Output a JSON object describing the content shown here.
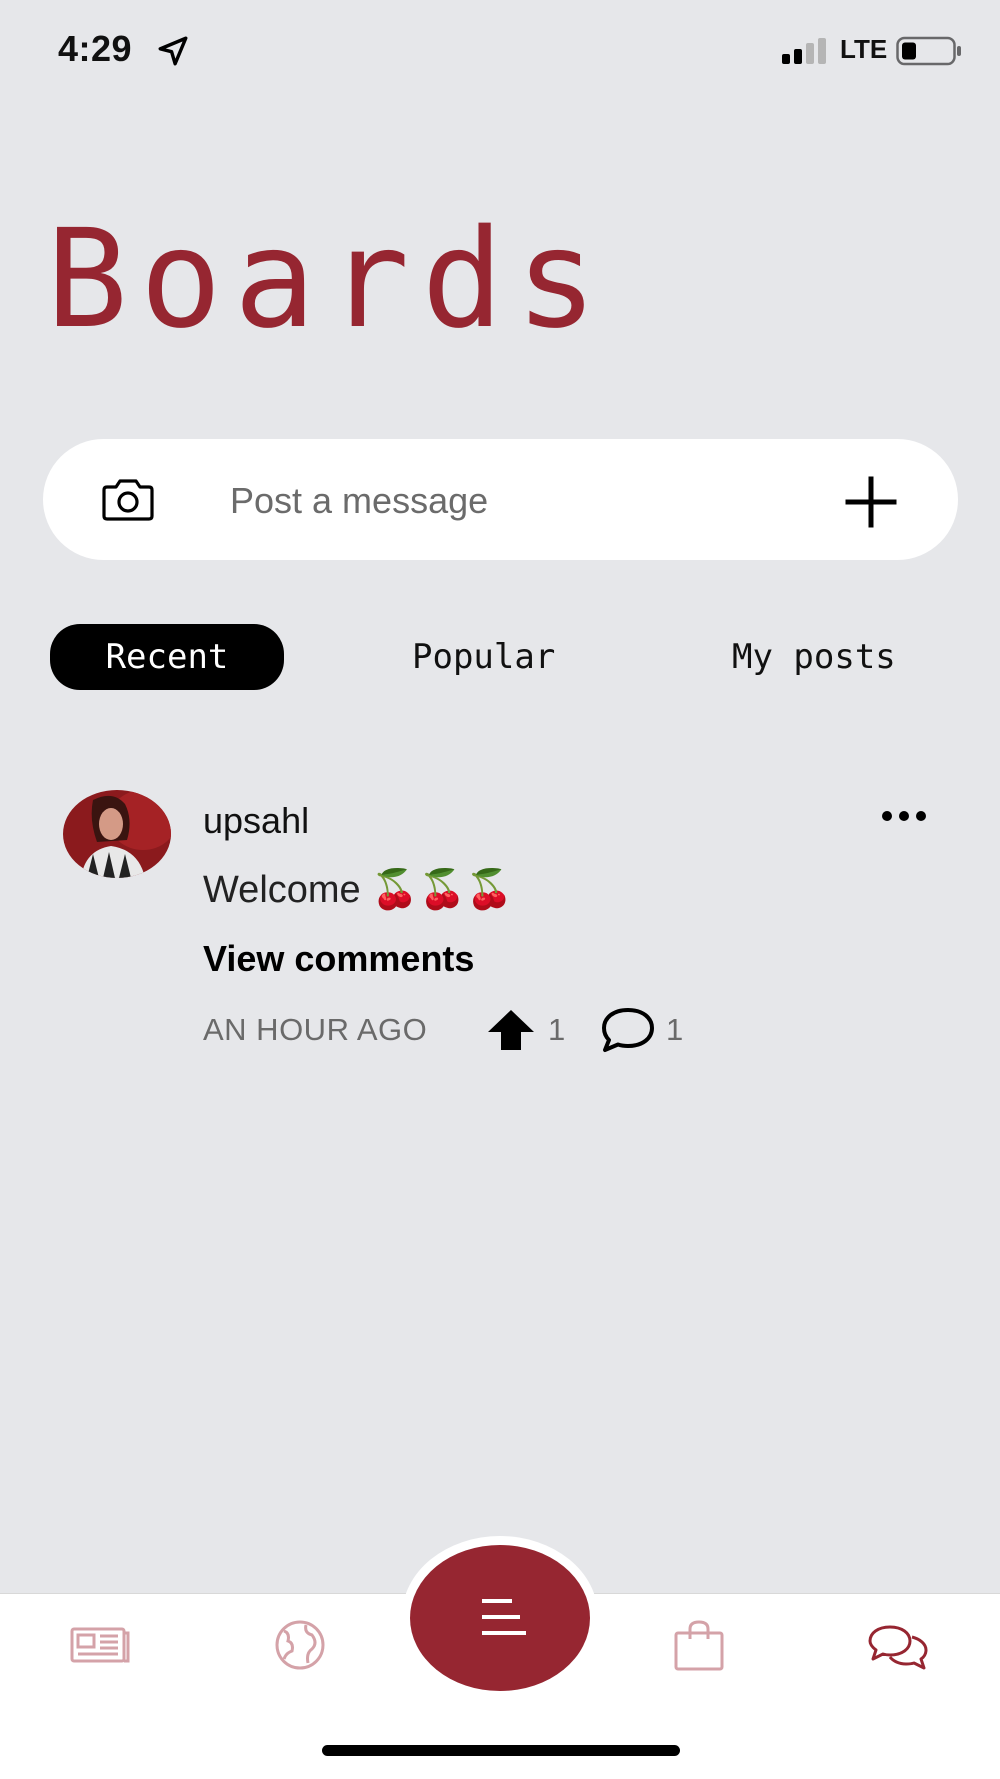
{
  "status_bar": {
    "time": "4:29",
    "network": "LTE",
    "icons": [
      "location-arrow-icon",
      "signal-icon",
      "battery-icon"
    ]
  },
  "page": {
    "title": "Boards",
    "accent_color": "#962631",
    "background_color": "#E6E7EA"
  },
  "composer": {
    "placeholder": "Post a message",
    "icons": [
      "camera-icon",
      "plus-icon"
    ]
  },
  "tabs": [
    {
      "label": "Recent",
      "selected": true
    },
    {
      "label": "Popular",
      "selected": false
    },
    {
      "label": "My posts",
      "selected": false
    }
  ],
  "posts": [
    {
      "username": "upsahl",
      "body": "Welcome 🍒🍒🍒",
      "view_comments_label": "View comments",
      "time": "AN HOUR AGO",
      "upvotes": "1",
      "comments": "1",
      "icons": [
        "avatar",
        "more-options-icon",
        "upvote-icon",
        "comment-icon"
      ]
    }
  ],
  "bottom_nav": {
    "items": [
      "news-icon",
      "globe-icon",
      "menu-icon",
      "shopping-bag-icon",
      "chat-bubbles-icon"
    ],
    "active": "chat-bubbles-icon"
  }
}
